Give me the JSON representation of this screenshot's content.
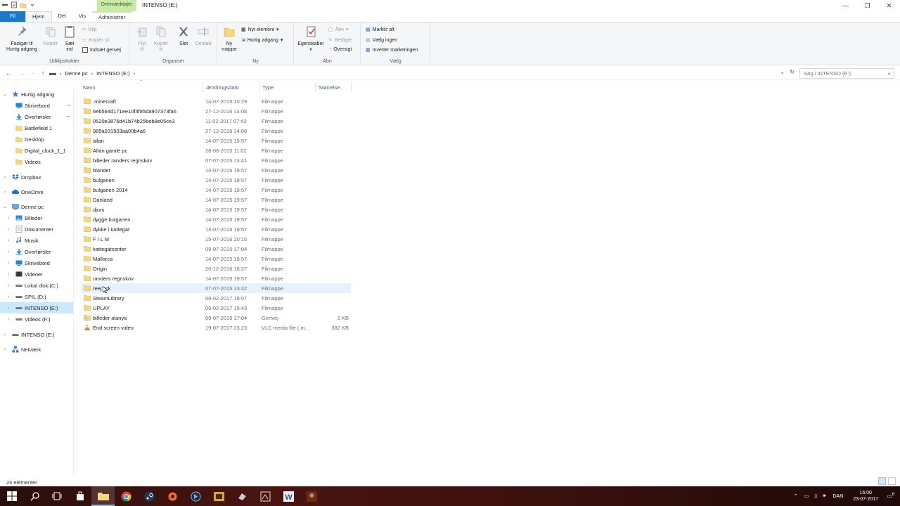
{
  "window": {
    "title": "INTENSO (E:)",
    "context_tab": "Drevværktøjer",
    "controls": {
      "minimize": "—",
      "maximize": "❐",
      "close": "✕"
    }
  },
  "ribbon_tabs": {
    "file": "Fil",
    "home": "Hjem",
    "share": "Del",
    "view": "Vis",
    "admin": "Administrer"
  },
  "ribbon": {
    "clipboard": {
      "pin": "Fastgør til\nHurtig adgang",
      "copy": "Kopiér",
      "paste": "Sæt\nind",
      "cut": "Klip",
      "copy_path": "Kopiér sti",
      "paste_shortcut": "Indsæt genvej",
      "label": "Udklipsholder"
    },
    "organize": {
      "move": "Flyt\ntil",
      "copy_to": "Kopiér\ntil",
      "delete": "Slet",
      "rename": "Omdøb",
      "label": "Organiser"
    },
    "new": {
      "new_folder": "Ny\nmappe",
      "new_item": "Nyt element",
      "easy_access": "Hurtig adgang",
      "label": "Ny"
    },
    "open": {
      "properties": "Egenskaber",
      "open": "Åbn",
      "edit": "Rediger",
      "history": "Oversigt",
      "label": "Åbn"
    },
    "select": {
      "select_all": "Markér alt",
      "select_none": "Vælg ingen",
      "invert": "Inverter markeringen",
      "label": "Vælg"
    }
  },
  "address": {
    "crumbs": [
      "Denne pc",
      "INTENSO (E:)"
    ],
    "search_placeholder": "Søg i INTENSO (E:)"
  },
  "nav": [
    {
      "label": "Hurtig adgang",
      "icon": "star-icon",
      "expander": "⌄",
      "pinned": false
    },
    {
      "label": "Skrivebord",
      "icon": "desktop-icon",
      "expander": "",
      "pinned": true
    },
    {
      "label": "Overførsler",
      "icon": "download-icon",
      "expander": "",
      "pinned": true
    },
    {
      "label": "Battlefield 1",
      "icon": "folder-icon",
      "expander": "",
      "pinned": false
    },
    {
      "label": "Desktop",
      "icon": "folder-icon",
      "expander": "",
      "pinned": false
    },
    {
      "label": "Digital_clock_1_1",
      "icon": "folder-icon",
      "expander": "",
      "pinned": false
    },
    {
      "label": "Videos",
      "icon": "folder-icon",
      "expander": "",
      "pinned": false
    },
    {
      "label": "Dropbox",
      "icon": "dropbox-icon",
      "expander": "›",
      "pinned": false
    },
    {
      "label": "OneDrive",
      "icon": "cloud-icon",
      "expander": "›",
      "pinned": false
    },
    {
      "label": "Denne pc",
      "icon": "pc-icon",
      "expander": "⌄",
      "pinned": false
    },
    {
      "label": "Billeder",
      "icon": "pictures-icon",
      "expander": "›",
      "pinned": false
    },
    {
      "label": "Dokumenter",
      "icon": "documents-icon",
      "expander": "›",
      "pinned": false
    },
    {
      "label": "Musik",
      "icon": "music-icon",
      "expander": "›",
      "pinned": false
    },
    {
      "label": "Overførsler",
      "icon": "download-icon",
      "expander": "›",
      "pinned": false
    },
    {
      "label": "Skrivebord",
      "icon": "desktop-icon",
      "expander": "›",
      "pinned": false
    },
    {
      "label": "Videoer",
      "icon": "video-icon",
      "expander": "›",
      "pinned": false
    },
    {
      "label": "Lokal disk (C:)",
      "icon": "drive-icon",
      "expander": "›",
      "pinned": false
    },
    {
      "label": "SPIL (D:)",
      "icon": "drive-icon",
      "expander": "›",
      "pinned": false
    },
    {
      "label": "INTENSO (E:)",
      "icon": "drive-icon",
      "expander": "›",
      "pinned": false,
      "selected": true
    },
    {
      "label": "Videos (F:)",
      "icon": "drive-icon",
      "expander": "›",
      "pinned": false
    },
    {
      "label": "INTENSO (E:)",
      "icon": "drive-icon",
      "expander": "›",
      "pinned": false
    },
    {
      "label": "Netværk",
      "icon": "network-icon",
      "expander": "›",
      "pinned": false
    }
  ],
  "columns": {
    "name": "Navn",
    "date": "Ændringsdato",
    "type": "Type",
    "size": "Størrelse"
  },
  "files": [
    {
      "name": ".minecraft",
      "date": "14-07-2015 10:29",
      "type": "Filmappe",
      "size": "",
      "icon": "folder-icon"
    },
    {
      "name": "6eb564d171ee10f4f85da907373fa6",
      "date": "27-12-2016 14:08",
      "type": "Filmappe",
      "size": "",
      "icon": "folder-icon"
    },
    {
      "name": "0520e3876d41b74b25beb8e05ce3",
      "date": "11-02-2017 07:42",
      "type": "Filmappe",
      "size": "",
      "icon": "folder-icon"
    },
    {
      "name": "985a031503aa00b4a6",
      "date": "27-12-2016 14:08",
      "type": "Filmappe",
      "size": "",
      "icon": "folder-icon"
    },
    {
      "name": "allan",
      "date": "14-07-2015 19:57",
      "type": "Filmappe",
      "size": "",
      "icon": "folder-icon"
    },
    {
      "name": "Allan gamle pc",
      "date": "28-06-2015 11:02",
      "type": "Filmappe",
      "size": "",
      "icon": "folder-icon"
    },
    {
      "name": "billeder randers regnskov",
      "date": "07-07-2015 13:41",
      "type": "Filmappe",
      "size": "",
      "icon": "folder-icon"
    },
    {
      "name": "blandet",
      "date": "14-07-2015 19:57",
      "type": "Filmappe",
      "size": "",
      "icon": "folder-icon"
    },
    {
      "name": "bulgarien",
      "date": "14-07-2015 19:57",
      "type": "Filmappe",
      "size": "",
      "icon": "folder-icon"
    },
    {
      "name": "bulgarien 2014",
      "date": "14-07-2015 19:57",
      "type": "Filmappe",
      "size": "",
      "icon": "folder-icon"
    },
    {
      "name": "Danland",
      "date": "14-07-2015 19:57",
      "type": "Filmappe",
      "size": "",
      "icon": "folder-icon"
    },
    {
      "name": "djurs",
      "date": "14-07-2015 19:57",
      "type": "Filmappe",
      "size": "",
      "icon": "folder-icon"
    },
    {
      "name": "dygge bulgarien",
      "date": "14-07-2015 19:57",
      "type": "Filmappe",
      "size": "",
      "icon": "folder-icon"
    },
    {
      "name": "dykke i kattegat",
      "date": "14-07-2015 19:57",
      "type": "Filmappe",
      "size": "",
      "icon": "folder-icon"
    },
    {
      "name": "F I L M",
      "date": "15-07-2016 20:15",
      "type": "Filmappe",
      "size": "",
      "icon": "folder-icon"
    },
    {
      "name": "kattegatcenter",
      "date": "09-07-2015 17:04",
      "type": "Filmappe",
      "size": "",
      "icon": "folder-icon"
    },
    {
      "name": "Mallorca",
      "date": "14-07-2015 19:57",
      "type": "Filmappe",
      "size": "",
      "icon": "folder-icon"
    },
    {
      "name": "Origin",
      "date": "26-12-2016 16:27",
      "type": "Filmappe",
      "size": "",
      "icon": "folder-icon"
    },
    {
      "name": "randers regnskov",
      "date": "14-07-2015 19:57",
      "type": "Filmappe",
      "size": "",
      "icon": "folder-icon"
    },
    {
      "name": "reeperk",
      "date": "07-07-2015 13:42",
      "type": "Filmappe",
      "size": "",
      "icon": "folder-icon",
      "hover": true
    },
    {
      "name": "SteamLibrary",
      "date": "08-02-2017 18:07",
      "type": "Filmappe",
      "size": "",
      "icon": "folder-icon"
    },
    {
      "name": "UPLAY",
      "date": "09-02-2017 15:43",
      "type": "Filmappe",
      "size": "",
      "icon": "folder-icon"
    },
    {
      "name": "billeder alanya",
      "date": "09-07-2015 17:04",
      "type": "Genvej",
      "size": "2 KB",
      "icon": "shortcut-icon"
    },
    {
      "name": "End screen video",
      "date": "19-07-2017 23:23",
      "type": "VLC media file (.m...",
      "size": "382 KB",
      "icon": "vlc-icon"
    }
  ],
  "status": {
    "count": "24 elementer"
  },
  "taskbar": {
    "lang": "DAN",
    "time": "16:00",
    "date": "23-07-2017",
    "notifications": "6"
  },
  "colors": {
    "accent": "#1979ca",
    "folder": "#f8d775",
    "selection": "#cce8ff",
    "hover": "#e5f3ff",
    "context_tab": "#c9e9a9"
  }
}
